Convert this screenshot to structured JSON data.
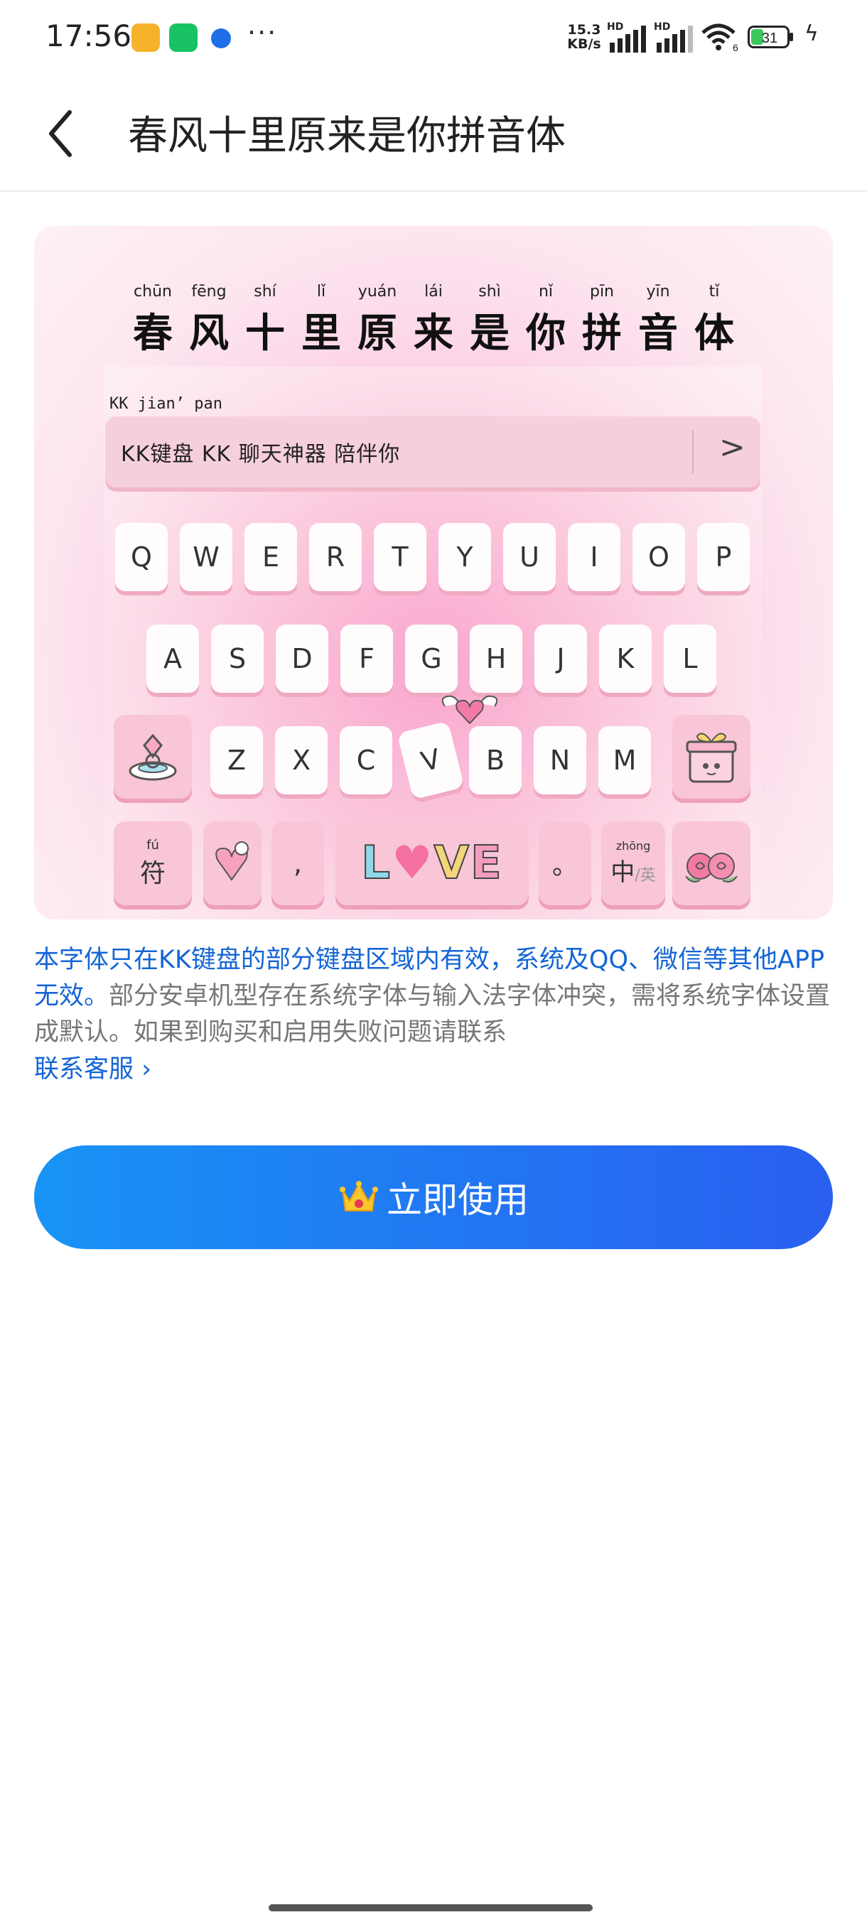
{
  "status_bar": {
    "time": "17:56",
    "net_speed_value": "15.3",
    "net_speed_unit": "KB/s",
    "sim1_label": "HD",
    "sim2_label": "HD",
    "wifi_label": "6",
    "battery_level": "31"
  },
  "header": {
    "title": "春风十里原来是你拼音体"
  },
  "preview": {
    "title_chars": [
      {
        "py": "chūn",
        "hz": "春"
      },
      {
        "py": "fēng",
        "hz": "风"
      },
      {
        "py": "shí",
        "hz": "十"
      },
      {
        "py": "lǐ",
        "hz": "里"
      },
      {
        "py": "yuán",
        "hz": "原"
      },
      {
        "py": "lái",
        "hz": "来"
      },
      {
        "py": "shì",
        "hz": "是"
      },
      {
        "py": "nǐ",
        "hz": "你"
      },
      {
        "py": "pīn",
        "hz": "拼"
      },
      {
        "py": "yīn",
        "hz": "音"
      },
      {
        "py": "tǐ",
        "hz": "体"
      }
    ],
    "compose_text": "KK jian’ pan",
    "candidates": "KK键盘  KK  聊天神器  陪伴你",
    "candidates_more": ">",
    "keys_row1": [
      "Q",
      "W",
      "E",
      "R",
      "T",
      "Y",
      "U",
      "I",
      "O",
      "P"
    ],
    "keys_row2": [
      "A",
      "S",
      "D",
      "F",
      "G",
      "H",
      "J",
      "K",
      "L"
    ],
    "keys_row3": [
      "Z",
      "X",
      "C",
      "V",
      "B",
      "N",
      "M"
    ],
    "key_symbol": "符",
    "key_symbol_py": "fú",
    "key_comma": ",",
    "key_period": "。",
    "key_lang": "中",
    "key_lang_py": "zhōng",
    "key_lang_alt": "/英",
    "space_love": [
      "L",
      "♥",
      "V",
      "E"
    ]
  },
  "info": {
    "blue_text": "本字体只在KK键盘的部分键盘区域内有效，系统及QQ、微信等其他APP无效。",
    "gray_text": "部分安卓机型存在系统字体与输入法字体冲突，需将系统字体设置成默认。如果到购买和启用失败问题请联系",
    "contact_link": "联系客服 ›"
  },
  "primary_button": {
    "icon": "crown-icon",
    "label": "立即使用"
  },
  "colors": {
    "accent": "#1465d6",
    "button_start": "#1893f5",
    "button_end": "#2a5ff0"
  }
}
